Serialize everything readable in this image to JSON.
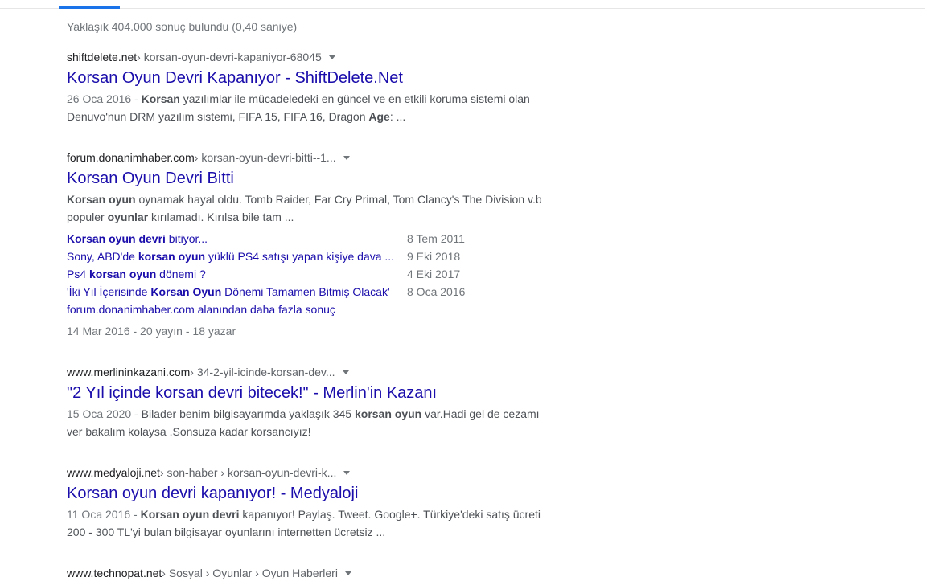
{
  "tabs": {
    "active_indicator_color": "#1a73e8"
  },
  "stats": "Yaklaşık 404.000 sonuç bulundu (0,40 saniye)",
  "results": [
    {
      "domain": "shiftdelete.net",
      "path": " › korsan-oyun-devri-kapaniyor-68045",
      "title": "Korsan Oyun Devri Kapanıyor - ShiftDelete.Net",
      "snippet": [
        {
          "text": "26 Oca 2016 - ",
          "style": "date"
        },
        {
          "text": "Korsan",
          "style": "b"
        },
        {
          "text": " yazılımlar ile mücadeledeki en güncel ve en etkili koruma sistemi olan Denuvo'nun DRM yazılım sistemi, FIFA 15, FIFA 16, Dragon "
        },
        {
          "text": "Age",
          "style": "b"
        },
        {
          "text": ": ..."
        }
      ]
    },
    {
      "domain": "forum.donanimhaber.com",
      "path": " › korsan-oyun-devri-bitti--1...",
      "title": "Korsan Oyun Devri Bitti",
      "snippet": [
        {
          "text": "Korsan oyun",
          "style": "b"
        },
        {
          "text": " oynamak hayal oldu. Tomb Raider, Far Cry Primal, Tom Clancy's The Division v.b populer "
        },
        {
          "text": "oyunlar",
          "style": "b"
        },
        {
          "text": " kırılamadı. Kırılsa bile tam ..."
        }
      ],
      "sitelinks": [
        {
          "parts": [
            {
              "text": "Korsan oyun devri",
              "style": "b"
            },
            {
              "text": " bitiyor..."
            }
          ],
          "date": "8 Tem 2011"
        },
        {
          "parts": [
            {
              "text": "Sony, ABD'de "
            },
            {
              "text": "korsan oyun",
              "style": "b"
            },
            {
              "text": " yüklü PS4 satışı yapan kişiye dava ..."
            }
          ],
          "date": "9 Eki 2018"
        },
        {
          "parts": [
            {
              "text": "Ps4 "
            },
            {
              "text": "korsan oyun",
              "style": "b"
            },
            {
              "text": " dönemi ?"
            }
          ],
          "date": "4 Eki 2017"
        },
        {
          "parts": [
            {
              "text": "'İki Yıl İçerisinde "
            },
            {
              "text": "Korsan Oyun",
              "style": "b"
            },
            {
              "text": " Dönemi Tamamen Bitmiş Olacak'"
            }
          ],
          "date": "8 Oca 2016"
        }
      ],
      "more_results": "forum.donanimhaber.com alanından daha fazla sonuç",
      "meta": "14 Mar 2016 - 20 yayın - 18 yazar"
    },
    {
      "domain": "www.merlininkazani.com",
      "path": " › 34-2-yil-icinde-korsan-dev...",
      "title": "\"2 Yıl içinde korsan devri bitecek!\" - Merlin'in Kazanı",
      "snippet": [
        {
          "text": "15 Oca 2020 - ",
          "style": "date"
        },
        {
          "text": "Bilader benim bilgisayarımda yaklaşık 345 "
        },
        {
          "text": "korsan oyun",
          "style": "b"
        },
        {
          "text": " var.Hadi gel de cezamı ver bakalım kolaysa .Sonsuza kadar korsancıyız!"
        }
      ]
    },
    {
      "domain": "www.medyaloji.net",
      "path": " › son-haber › korsan-oyun-devri-k...",
      "title": "Korsan oyun devri kapanıyor! - Medyaloji",
      "snippet": [
        {
          "text": "11 Oca 2016 - ",
          "style": "date"
        },
        {
          "text": "Korsan oyun devri",
          "style": "b"
        },
        {
          "text": " kapanıyor! Paylaş. Tweet. Google+. Türkiye'deki satış ücreti 200 - 300 TL'yi bulan bilgisayar oyunlarını internetten ücretsiz ..."
        }
      ]
    },
    {
      "domain": "www.technopat.net",
      "path": " › Sosyal › Oyunlar › Oyun Haberleri"
    }
  ]
}
